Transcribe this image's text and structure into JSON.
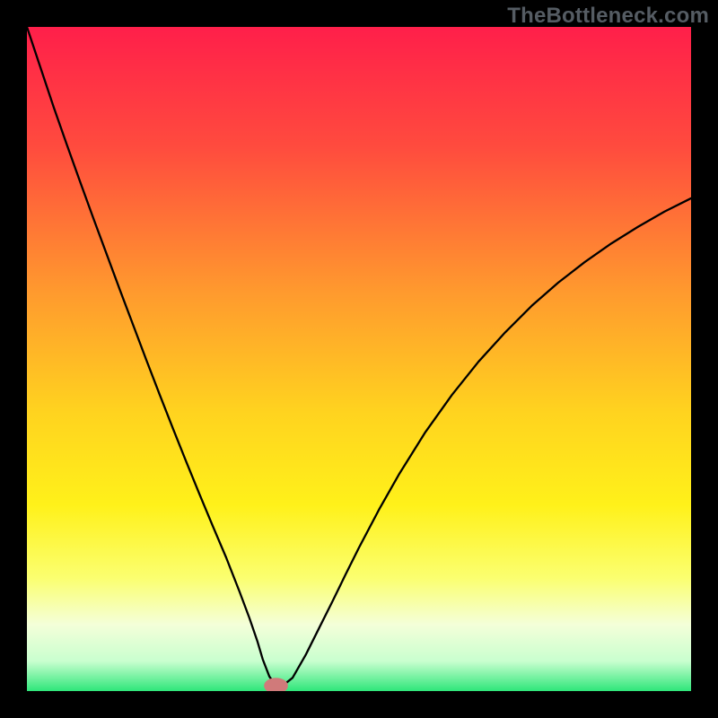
{
  "watermark": "TheBottleneck.com",
  "chart_data": {
    "type": "line",
    "title": "",
    "xlabel": "",
    "ylabel": "",
    "xlim": [
      0,
      100
    ],
    "ylim": [
      0,
      100
    ],
    "grid": false,
    "gradient_stops": [
      {
        "offset": 0.0,
        "color": "#ff1f4a"
      },
      {
        "offset": 0.18,
        "color": "#ff4b3e"
      },
      {
        "offset": 0.4,
        "color": "#ff9a2e"
      },
      {
        "offset": 0.58,
        "color": "#ffd31f"
      },
      {
        "offset": 0.72,
        "color": "#fff11a"
      },
      {
        "offset": 0.83,
        "color": "#fbff70"
      },
      {
        "offset": 0.9,
        "color": "#f4ffd9"
      },
      {
        "offset": 0.955,
        "color": "#c9ffcf"
      },
      {
        "offset": 1.0,
        "color": "#2fe67a"
      }
    ],
    "minimum_marker": {
      "x": 37.5,
      "y": 0.8,
      "rx": 1.8,
      "ry": 1.2,
      "fill": "#d07a7a"
    },
    "series": [
      {
        "name": "curve",
        "stroke": "#000000",
        "stroke_width": 2.3,
        "x": [
          0.0,
          2,
          4,
          6,
          8,
          10,
          12,
          14,
          16,
          18,
          20,
          22,
          24,
          26,
          28,
          30,
          32,
          33.5,
          34.7,
          35.5,
          36.5,
          37.5,
          38.5,
          40,
          42,
          44,
          46,
          48,
          50,
          53,
          56,
          60,
          64,
          68,
          72,
          76,
          80,
          84,
          88,
          92,
          96,
          100
        ],
        "y": [
          100,
          94,
          88,
          82.3,
          76.7,
          71.2,
          65.8,
          60.4,
          55.1,
          49.8,
          44.6,
          39.5,
          34.5,
          29.6,
          24.8,
          20.1,
          15.0,
          11.0,
          7.5,
          4.8,
          2.2,
          0.8,
          0.8,
          2.0,
          5.5,
          9.5,
          13.5,
          17.6,
          21.6,
          27.3,
          32.6,
          39.0,
          44.6,
          49.6,
          54.0,
          58.0,
          61.5,
          64.6,
          67.4,
          69.9,
          72.2,
          74.2
        ]
      }
    ]
  }
}
